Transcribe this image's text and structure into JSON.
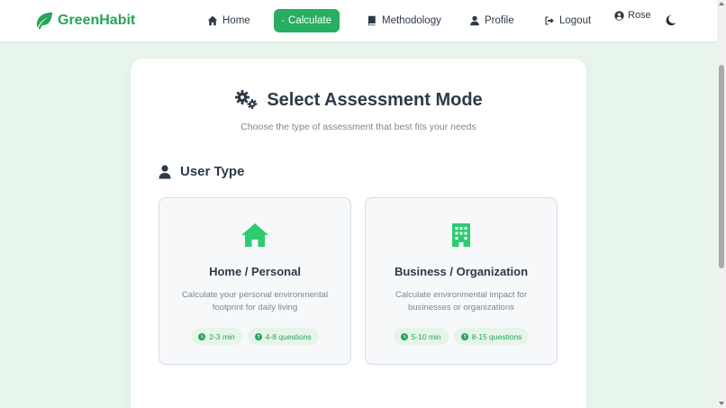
{
  "brand": {
    "name": "GreenHabit",
    "icon": "leaf-icon",
    "color": "#27a559"
  },
  "nav": {
    "items": [
      {
        "label": "Home",
        "icon": "house-icon"
      },
      {
        "label": "Calculate",
        "icon": "calculator-icon",
        "active": true
      },
      {
        "label": "Methodology",
        "icon": "book-icon"
      },
      {
        "label": "Profile",
        "icon": "user-icon"
      },
      {
        "label": "Logout",
        "icon": "sign-out-icon"
      }
    ],
    "user": {
      "label": "Rose",
      "icon": "user-circle-icon"
    },
    "theme_toggle_icon": "moon-icon",
    "active_color": "#27ae60"
  },
  "main": {
    "title": "Select Assessment Mode",
    "title_icon": "cogs-icon",
    "subtitle": "Choose the type of assessment that best fits your needs",
    "section": {
      "title": "User Type",
      "icon": "user-icon"
    },
    "options": [
      {
        "title": "Home / Personal",
        "icon": "house-icon",
        "description": "Calculate your personal environmental footprint for daily living",
        "badges": [
          {
            "label": "2-3 min",
            "icon": "clock-icon"
          },
          {
            "label": "4-8 questions",
            "icon": "question-circle-icon"
          }
        ]
      },
      {
        "title": "Business / Organization",
        "icon": "building-icon",
        "description": "Calculate environmental impact for businesses or organizations",
        "badges": [
          {
            "label": "5-10 min",
            "icon": "clock-icon"
          },
          {
            "label": "8-15 questions",
            "icon": "question-circle-icon"
          }
        ]
      }
    ]
  },
  "colors": {
    "background": "#e8f5ec",
    "accent": "#27ae60",
    "text": "#2d3a48",
    "muted": "#7b8794"
  }
}
